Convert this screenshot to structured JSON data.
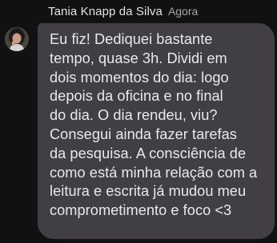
{
  "message": {
    "sender_name": "Tania Knapp da Silva",
    "timestamp": "Agora",
    "avatar_icon": "user-avatar-photo",
    "lines": [
      "Eu fiz! Dediquei bastante",
      "tempo, quase 3h. Dividi em",
      "dois momentos do dia: logo",
      "depois da oficina e no final",
      "do dia. O dia rendeu, viu?",
      "Consegui ainda fazer tarefas",
      "da pesquisa. A consciência de",
      "como está minha relação com a",
      "leitura e escrita já mudou meu",
      "comprometimento e foco <3"
    ]
  },
  "colors": {
    "background": "#111111",
    "bubble": "#413f44",
    "text": "#ece7ee",
    "meta": "#a8a3a8"
  }
}
